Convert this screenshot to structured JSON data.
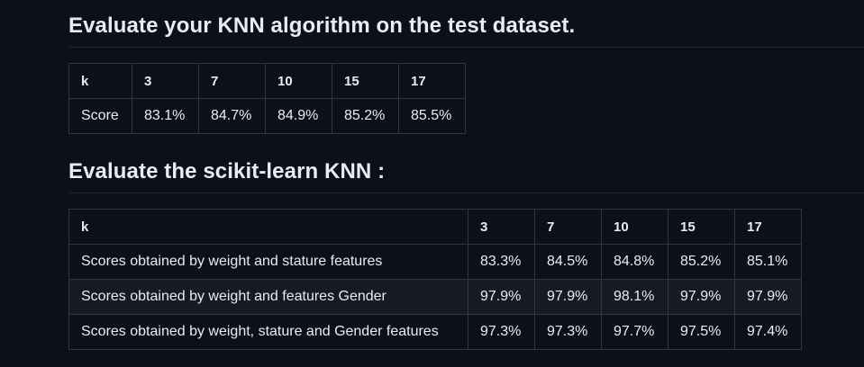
{
  "section1": {
    "title": "Evaluate your KNN algorithm on the test dataset.",
    "table": {
      "header": [
        "k",
        "3",
        "7",
        "10",
        "15",
        "17"
      ],
      "rows": [
        [
          "Score",
          "83.1%",
          "84.7%",
          "84.9%",
          "85.2%",
          "85.5%"
        ]
      ]
    }
  },
  "section2": {
    "title": "Evaluate the scikit-learn KNN :",
    "table": {
      "header": [
        "k",
        "3",
        "7",
        "10",
        "15",
        "17"
      ],
      "rows": [
        [
          "Scores obtained by weight and stature features",
          "83.3%",
          "84.5%",
          "84.8%",
          "85.2%",
          "85.1%"
        ],
        [
          "Scores obtained by weight and features Gender",
          "97.9%",
          "97.9%",
          "98.1%",
          "97.9%",
          "97.9%"
        ],
        [
          "Scores obtained by weight, stature and Gender features",
          "97.3%",
          "97.3%",
          "97.7%",
          "97.5%",
          "97.4%"
        ]
      ]
    }
  }
}
